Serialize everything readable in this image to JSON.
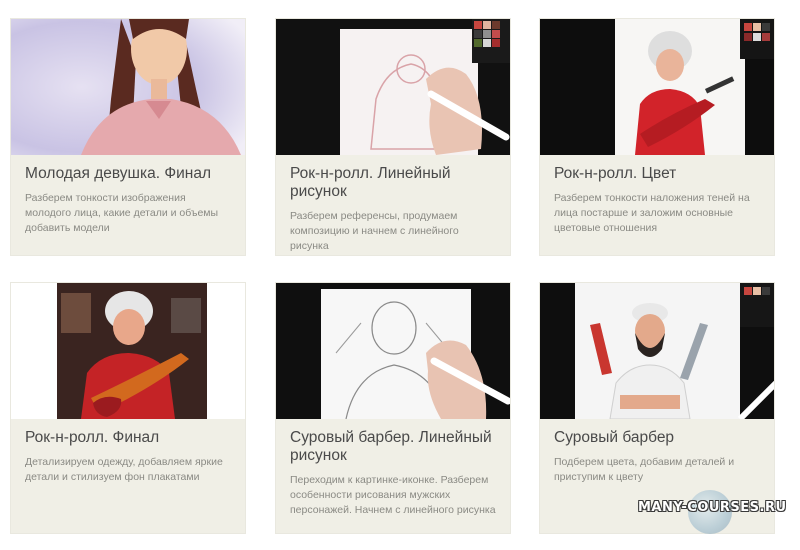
{
  "cards": [
    {
      "title": "Молодая девушка. Финал",
      "desc": "Разберем тонкости изображения молодого лица, какие детали и объемы добавить модели",
      "image": "young-woman-portrait"
    },
    {
      "title": "Рок-н-ролл. Линейный рисунок",
      "desc": "Разберем референсы, продумаем композицию и начнем с линейного рисунка",
      "image": "tablet-line-sketch"
    },
    {
      "title": "Рок-н-ролл. Цвет",
      "desc": "Разберем тонкости наложения теней на лица постарше и заложим основные цветовые отношения",
      "image": "rock-granny-color"
    },
    {
      "title": "Рок-н-ролл. Финал",
      "desc": "Детализируем одежду, добавляем яркие детали и стилизуем фон плакатами",
      "image": "rock-granny-final"
    },
    {
      "title": "Суровый барбер. Линейный рисунок",
      "desc": "Переходим к картинке-иконке. Разберем особенности рисования мужских персонажей. Начнем с линейного рисунка",
      "image": "barber-line-sketch"
    },
    {
      "title": "Суровый барбер",
      "desc": "Подберем цвета, добавим деталей и приступим к цвету",
      "image": "barber-color"
    }
  ],
  "watermark": "MANY-COURSES.RU"
}
